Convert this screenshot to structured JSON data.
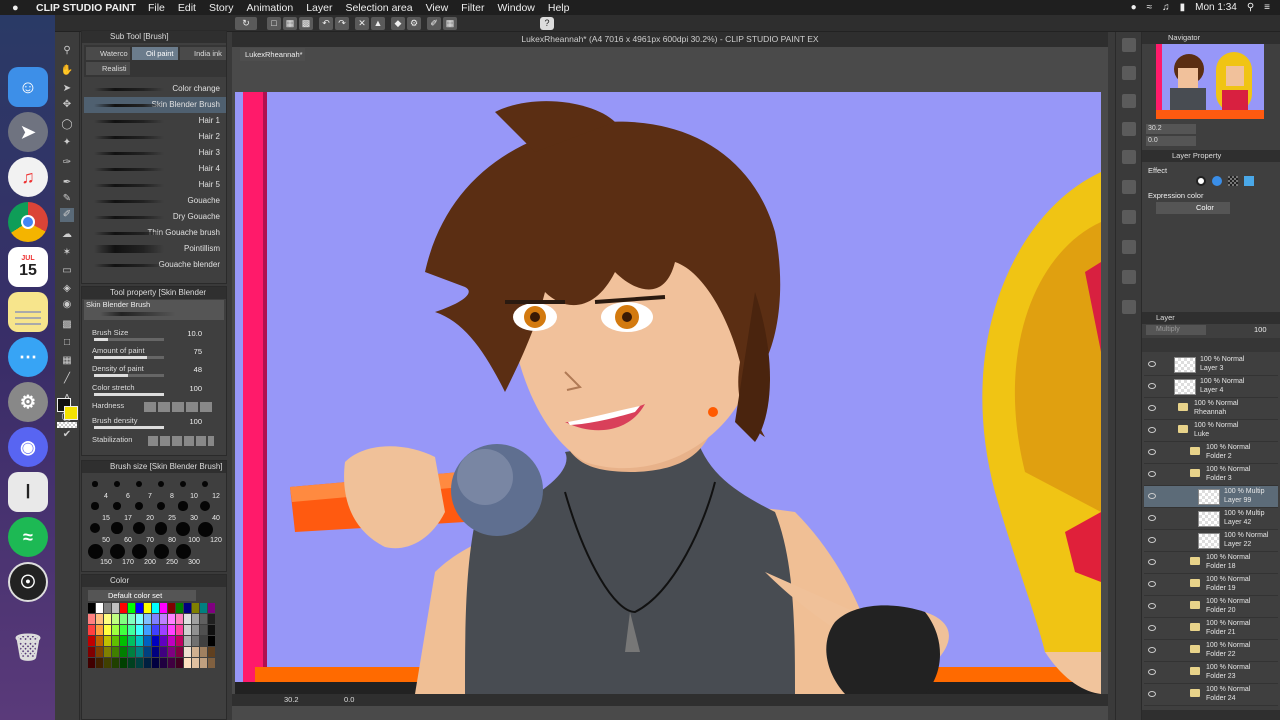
{
  "menubar": {
    "apple": "",
    "app_name": "CLIP STUDIO PAINT",
    "menus": [
      "File",
      "Edit",
      "Story",
      "Animation",
      "Layer",
      "Selection area",
      "View",
      "Filter",
      "Window",
      "Help"
    ],
    "clock": "Mon 1:34"
  },
  "dock": {
    "calendar_month": "JUL",
    "calendar_day": "15"
  },
  "document": {
    "title": "LukexRheannah* (A4 7016 x 4961px 600dpi 30.2%)  - CLIP STUDIO PAINT EX",
    "tab": "LukexRheannah*",
    "zoom": "30.2",
    "rotation": "0.0"
  },
  "subtool": {
    "header": "Sub Tool [Brush]",
    "tabs": [
      "Waterco",
      "Oil paint",
      "India ink",
      "Realisti"
    ],
    "brushes": [
      "Color change",
      "Skin Blender Brush",
      "Hair 1",
      "Hair 2",
      "Hair 3",
      "Hair 4",
      "Hair 5",
      "Gouache",
      "Dry Gouache",
      "Thin Gouache brush",
      "Pointillism",
      "Gouache blender"
    ],
    "selected_index": 1
  },
  "tool_property": {
    "header": "Tool property [Skin Blender Brush]",
    "brush_name": "Skin Blender Brush",
    "rows": [
      {
        "label": "Brush Size",
        "value": "10.0",
        "fill": 0.2
      },
      {
        "label": "Amount of paint",
        "value": "75",
        "fill": 0.75
      },
      {
        "label": "Density of paint",
        "value": "48",
        "fill": 0.48
      },
      {
        "label": "Color stretch",
        "value": "100",
        "fill": 1.0
      },
      {
        "label": "Hardness",
        "value": "",
        "fill": 0
      },
      {
        "label": "Brush density",
        "value": "100",
        "fill": 1.0
      },
      {
        "label": "Stabilization",
        "value": "",
        "fill": 0
      }
    ]
  },
  "brush_size": {
    "header": "Brush size [Skin Blender Brush]",
    "sizes": [
      "4",
      "6",
      "7",
      "8",
      "10",
      "12",
      "15",
      "17",
      "20",
      "25",
      "30",
      "40",
      "50",
      "60",
      "70",
      "80",
      "100",
      "120",
      "150",
      "170",
      "200",
      "250",
      "300"
    ]
  },
  "color_set": {
    "header": "Color",
    "set_name": "Default color set"
  },
  "navigator": {
    "header": "Navigator",
    "zoom": "30.2",
    "rotation": "0.0"
  },
  "layer_property": {
    "header": "Layer Property",
    "effect_label": "Effect",
    "expression_label": "Expression color",
    "expression_value": "Color"
  },
  "layer_panel": {
    "header": "Layer",
    "blend_mode": "Multiply",
    "opacity": "100",
    "layers": [
      {
        "mode": "100 % Normal",
        "name": "Layer 3",
        "kind": "layer",
        "indent": 0
      },
      {
        "mode": "100 % Normal",
        "name": "Layer 4",
        "kind": "layer",
        "indent": 0
      },
      {
        "mode": "100 % Normal",
        "name": "Rheannah",
        "kind": "folder",
        "indent": 0
      },
      {
        "mode": "100 % Normal",
        "name": "Luke",
        "kind": "folder",
        "indent": 0
      },
      {
        "mode": "100 % Normal",
        "name": "Folder 2",
        "kind": "folder",
        "indent": 1
      },
      {
        "mode": "100 % Normal",
        "name": "Folder 3",
        "kind": "folder",
        "indent": 1
      },
      {
        "mode": "100 % Multip",
        "name": "Layer 99",
        "kind": "layer",
        "indent": 2
      },
      {
        "mode": "100 % Multip",
        "name": "Layer 42",
        "kind": "layer",
        "indent": 2
      },
      {
        "mode": "100 % Normal",
        "name": "Layer 22",
        "kind": "layer",
        "indent": 2
      },
      {
        "mode": "100 % Normal",
        "name": "Folder 18",
        "kind": "folder",
        "indent": 1
      },
      {
        "mode": "100 % Normal",
        "name": "Folder 19",
        "kind": "folder",
        "indent": 1
      },
      {
        "mode": "100 % Normal",
        "name": "Folder 20",
        "kind": "folder",
        "indent": 1
      },
      {
        "mode": "100 % Normal",
        "name": "Folder 21",
        "kind": "folder",
        "indent": 1
      },
      {
        "mode": "100 % Normal",
        "name": "Folder 22",
        "kind": "folder",
        "indent": 1
      },
      {
        "mode": "100 % Normal",
        "name": "Folder 23",
        "kind": "folder",
        "indent": 1
      },
      {
        "mode": "100 % Normal",
        "name": "Folder 24",
        "kind": "folder",
        "indent": 1
      }
    ],
    "selected_index": 6
  },
  "colors": {
    "canvas_bg": "#9797f8",
    "accent_pink": "#ff1a6a",
    "panel_bg": "#3f3f3f"
  }
}
